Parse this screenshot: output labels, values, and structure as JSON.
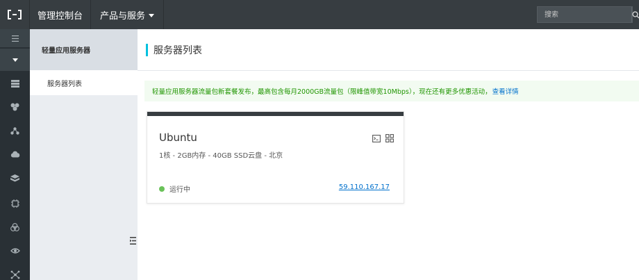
{
  "topbar": {
    "console_label": "管理控制台",
    "products_label": "产品与服务",
    "search_placeholder": "搜索"
  },
  "subnav": {
    "title": "轻量应用服务器",
    "items": [
      {
        "label": "服务器列表"
      }
    ]
  },
  "main": {
    "page_title": "服务器列表",
    "notice": {
      "text": "轻量应用服务器流量包新套餐发布，最高包含每月2000GB流量包（限峰值带宽10Mbps），现在还有更多优惠活动，",
      "link": "查看详情"
    },
    "server_card": {
      "name": "Ubuntu",
      "spec": "1核 - 2GB内存 - 40GB SSD云盘 - 北京",
      "status": "运行中",
      "ip": "59.110.167.17"
    }
  },
  "colors": {
    "topbar_bg": "#373d41",
    "rail_bg": "#293035",
    "accent": "#00c1de",
    "notice_text": "#1f9500",
    "link": "#0070cc",
    "status_running": "#6ac259"
  },
  "icons": {
    "rail": [
      "menu-icon",
      "list-icon",
      "cluster-icon",
      "nodes-icon",
      "cloud-icon",
      "database-icon",
      "chip-icon",
      "circles-icon",
      "eye-icon",
      "network-icon"
    ],
    "card": [
      "terminal-icon",
      "grid-icon"
    ]
  }
}
